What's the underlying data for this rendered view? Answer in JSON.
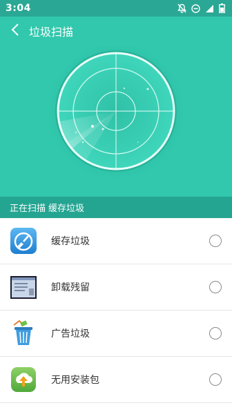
{
  "statusbar": {
    "time": "3:04",
    "icons": [
      "notifications-off-icon",
      "do-not-disturb-icon",
      "cellular-signal-icon",
      "battery-icon"
    ]
  },
  "toolbar": {
    "back_icon": "chevron-left-icon",
    "title": "垃圾扫描"
  },
  "scan": {
    "status_label": "正在扫描",
    "status_target": "缓存垃圾"
  },
  "items": [
    {
      "label": "缓存垃圾",
      "icon": "cache-cleaner-icon",
      "checked": false
    },
    {
      "label": "卸载残留",
      "icon": "uninstall-residue-icon",
      "checked": false
    },
    {
      "label": "广告垃圾",
      "icon": "ad-trash-icon",
      "checked": false
    },
    {
      "label": "无用安装包",
      "icon": "apk-package-icon",
      "checked": false
    }
  ],
  "colors": {
    "statusbar": "#2aa895",
    "primary": "#31c8ad",
    "status_strip": "#24a592"
  }
}
